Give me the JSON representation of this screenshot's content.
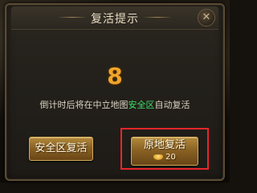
{
  "dialog": {
    "title": "复活提示",
    "close_symbol": "✕",
    "countdown": "8",
    "message_before": "倒计时后将在中立地图",
    "message_highlight": "安全区",
    "message_after": "自动复活",
    "highlight_color": "#3ee06a",
    "countdown_color": "#f0a52a"
  },
  "buttons": {
    "safe_zone_label": "安全区复活",
    "revive_label": "原地复活",
    "revive_cost": "20",
    "revive_cost_icon": "gold-ingot-icon"
  },
  "annotation": {
    "frame_color": "#e8262b"
  }
}
